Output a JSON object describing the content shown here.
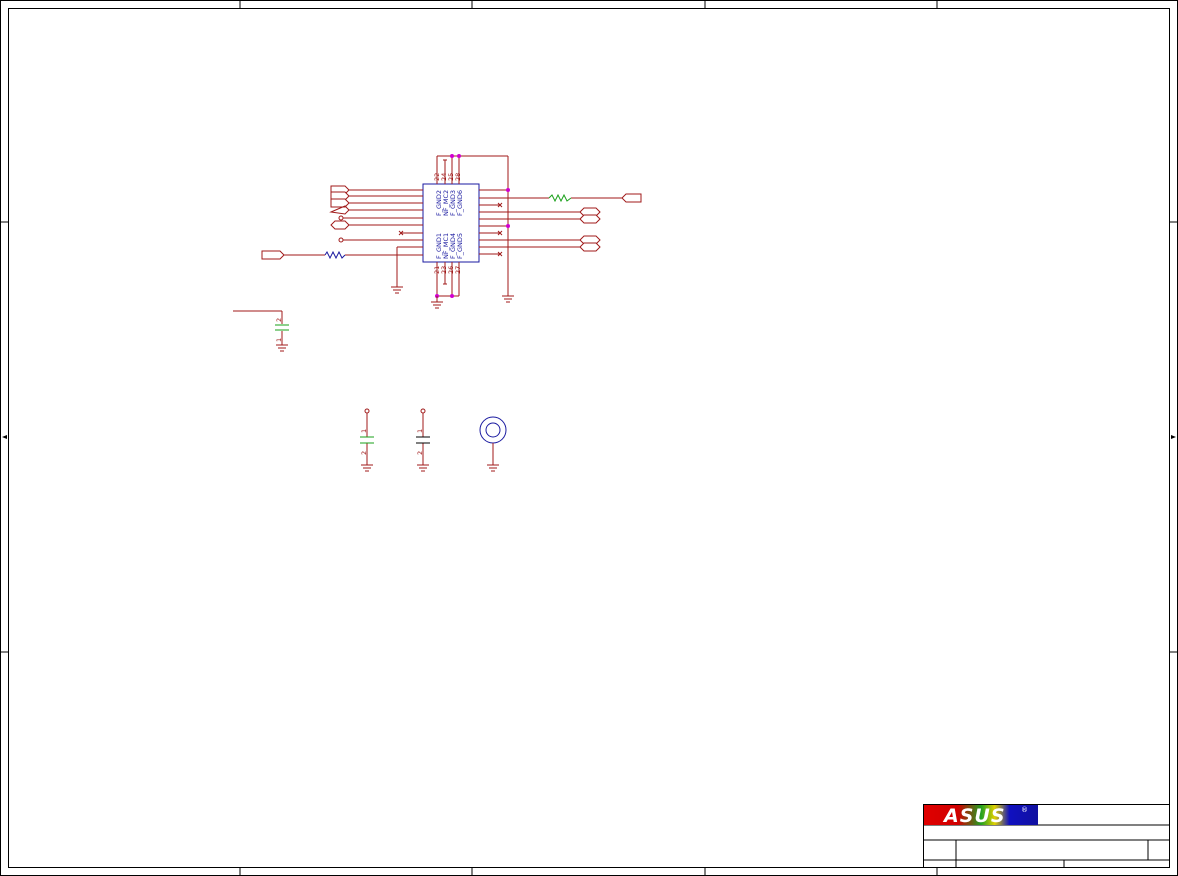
{
  "connector": {
    "pins_top": [
      "22",
      "24",
      "25",
      "28"
    ],
    "pins_bottom": [
      "21",
      "23",
      "26",
      "27"
    ],
    "labels_top": [
      "F_GND2",
      "NF_MC2",
      "F_GND3",
      "F_GND6"
    ],
    "labels_bottom": [
      "F_GND1",
      "NF_MC1",
      "F_GND4",
      "F_GND5"
    ]
  },
  "cap_c1": {
    "pin_top": "2",
    "pin_bottom": "1"
  },
  "cap_c2": {
    "pin_top": "1",
    "pin_bottom": "2"
  },
  "cap_c3": {
    "pin_top": "1",
    "pin_bottom": "2"
  },
  "title_block": {
    "logo_text": "ASUS",
    "registered": "®"
  },
  "colors": {
    "wire": "#a01a1a",
    "junction": "#d000d0",
    "component": "#1a1aa0",
    "resistor_green": "#1aa01a",
    "capacitor_green": "#1aa01a"
  }
}
